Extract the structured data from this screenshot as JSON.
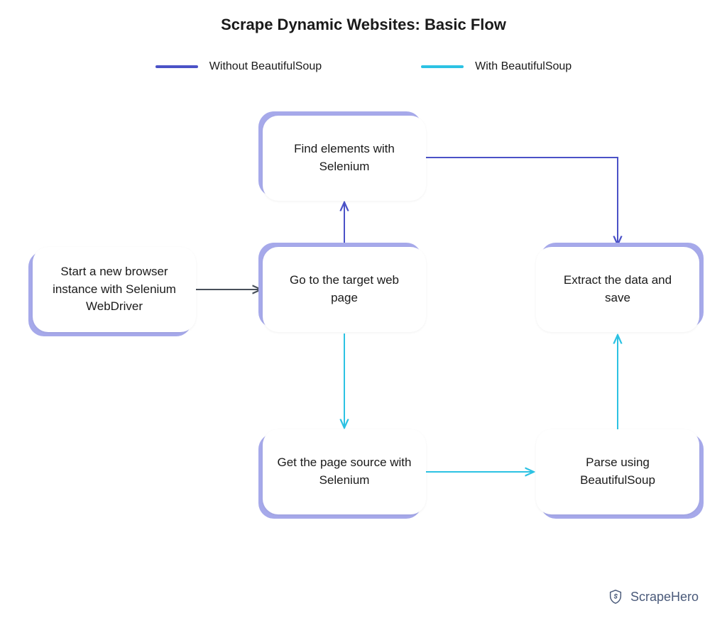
{
  "title": "Scrape Dynamic Websites: Basic Flow",
  "legend": {
    "without": {
      "label": "Without BeautifulSoup",
      "color": "#4b52c7"
    },
    "with": {
      "label": "With BeautifulSoup",
      "color": "#2cc2e3"
    }
  },
  "colors": {
    "box_back": "#a6a9ea",
    "box_front": "#ffffff",
    "neutral_connector": "#48505a"
  },
  "nodes": {
    "start": {
      "label": "Start a new browser instance with Selenium WebDriver"
    },
    "goto": {
      "label": "Go to the target web page"
    },
    "find": {
      "label": "Find elements with Selenium"
    },
    "page_source": {
      "label": "Get the page source with Selenium"
    },
    "parse": {
      "label": "Parse using BeautifulSoup"
    },
    "extract": {
      "label": "Extract the data and save"
    }
  },
  "edges": [
    {
      "from": "start",
      "to": "goto",
      "path": "without",
      "color": "neutral"
    },
    {
      "from": "goto",
      "to": "find",
      "path": "without"
    },
    {
      "from": "find",
      "to": "extract",
      "path": "without"
    },
    {
      "from": "goto",
      "to": "page_source",
      "path": "with"
    },
    {
      "from": "page_source",
      "to": "parse",
      "path": "with"
    },
    {
      "from": "parse",
      "to": "extract",
      "path": "with"
    }
  ],
  "footer": {
    "brand": "ScrapeHero"
  }
}
